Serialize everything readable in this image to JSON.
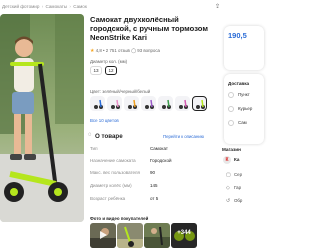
{
  "breadcrumb": [
    "Детский фотомир",
    "Самокаты",
    "Самок"
  ],
  "product": {
    "title": "Самокат двухколёсный городской, с ручным тормозом NeonStrike Kari",
    "rating": "4,8 • 2 751 отзыв",
    "rating_extra": "93 вопроса",
    "size_label": "Диаметр кол. (мм)",
    "sizes": [
      "13",
      "12"
    ],
    "color_label": "Цвет: зелёный/черный/белый",
    "all_colors": "Все 10 цветов"
  },
  "about": {
    "title": "О товаре",
    "link": "Перейти к описанию",
    "specs": [
      {
        "k": "Тип",
        "v": "Самокат"
      },
      {
        "k": "Назначение самоката",
        "v": "Городской"
      },
      {
        "k": "Макс. вес пользователя",
        "v": "90"
      },
      {
        "k": "Диаметр колёс (мм)",
        "v": "145"
      },
      {
        "k": "Возраст ребёнка",
        "v": "от 5"
      }
    ]
  },
  "videos": {
    "title": "Фото и видео покупателей",
    "more": "+344"
  },
  "price": {
    "value": "190,5"
  },
  "delivery": {
    "title": "Доставка",
    "options": [
      "Пункт",
      "Курьер",
      "Сам"
    ]
  },
  "seller": {
    "title": "Магазин",
    "logo": "К",
    "name": "Ка",
    "rows": [
      "Сер",
      "Гар",
      "Обр"
    ]
  },
  "colors": {
    "accent": "#2a6bd6",
    "scooter_green": "#b5e61d"
  }
}
